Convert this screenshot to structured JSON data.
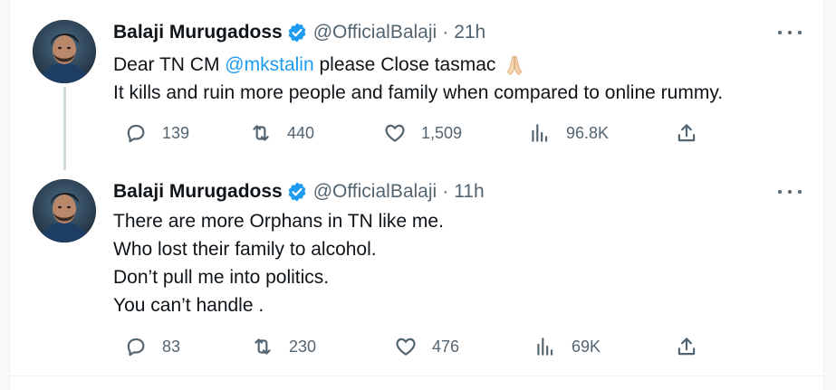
{
  "tweets": [
    {
      "author": "Balaji Murugadoss",
      "handle": "@OfficialBalaji",
      "separator": "·",
      "time": "21h",
      "text_before_mention": "Dear TN CM ",
      "mention": "@mkstalin",
      "text_after_mention": " please Close tasmac",
      "line2": "It kills and ruin more people and family when compared to online rummy.",
      "emoji": "folded-hands-emoji",
      "replies": "139",
      "reposts": "440",
      "likes": "1,509",
      "views": "96.8K"
    },
    {
      "author": "Balaji Murugadoss",
      "handle": "@OfficialBalaji",
      "separator": "·",
      "time": "11h",
      "lines": [
        "There are more Orphans in TN like me.",
        "Who lost their family to alcohol.",
        "Don’t pull me into politics.",
        "You can’t handle ."
      ],
      "replies": "83",
      "reposts": "230",
      "likes": "476",
      "views": "69K"
    }
  ],
  "icons": {
    "verified": "verified-badge-icon",
    "more": "more-dots-icon",
    "reply": "reply-icon",
    "repost": "repost-icon",
    "like": "like-icon",
    "views": "views-icon",
    "share": "share-icon"
  },
  "colors": {
    "accent": "#1d9bf0",
    "text": "#0f1419",
    "muted": "#536471",
    "background": "#f7f9f9",
    "card": "#ffffff",
    "thread_line": "#cfd9de"
  }
}
